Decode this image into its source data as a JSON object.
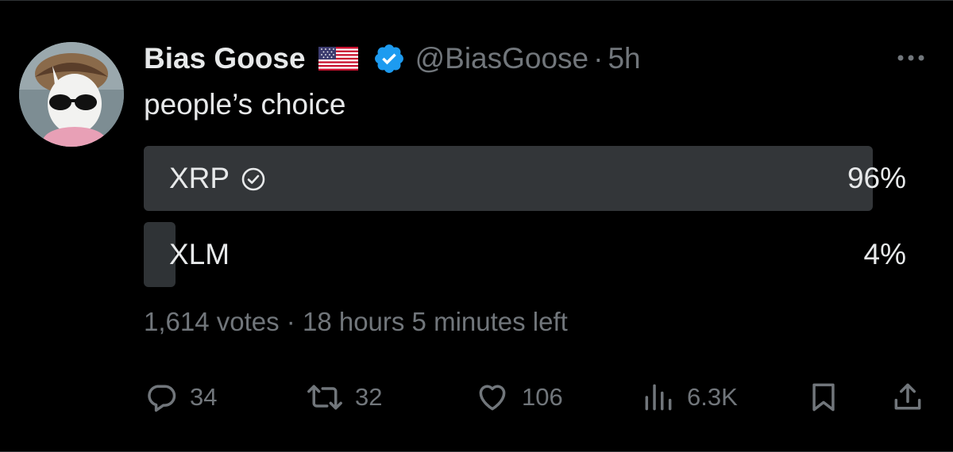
{
  "tweet": {
    "author_name": "Bias Goose",
    "author_flag_icon": "us-flag-icon",
    "verified_icon": "verified-badge-icon",
    "handle": "@BiasGoose",
    "separator": "·",
    "time": "5h",
    "text": "people’s choice"
  },
  "poll": {
    "options": [
      {
        "label": "XRP",
        "percent_label": "96%",
        "fraction": 0.96,
        "selected": true
      },
      {
        "label": "XLM",
        "percent_label": "4%",
        "fraction": 0.04,
        "selected": false
      }
    ],
    "votes": "1,614 votes",
    "separator": "·",
    "time_left": "18 hours 5 minutes left"
  },
  "actions": {
    "reply_count": "34",
    "repost_count": "32",
    "like_count": "106",
    "views_count": "6.3K"
  },
  "colors": {
    "background": "#000000",
    "text_primary": "#e7e9ea",
    "text_secondary": "#71767b",
    "poll_fill": "#333639",
    "verified_blue": "#1d9bf0"
  }
}
